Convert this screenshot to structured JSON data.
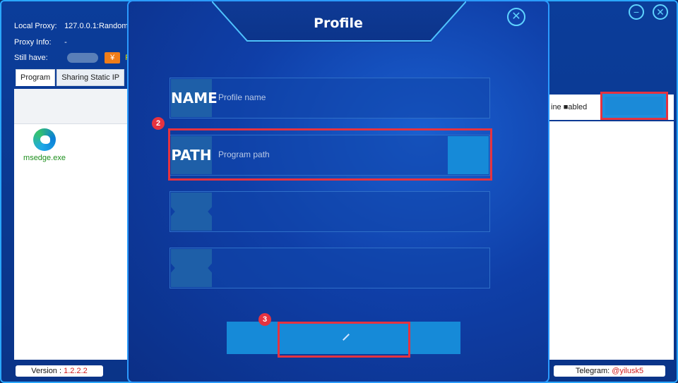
{
  "background": {
    "info": {
      "local_proxy_label": "Local Proxy:",
      "local_proxy_value": "127.0.0.1:Random",
      "proxy_info_label": "Proxy Info:",
      "proxy_info_value": "-",
      "still_have_label": "Still have:",
      "yen": "¥",
      "re_text": "Re"
    },
    "tabs": [
      "Program",
      "Sharing Static IP"
    ],
    "programs": [
      {
        "label": "msedge.exe",
        "icon": "edge-icon"
      }
    ],
    "right_column_label": "ine ■abled",
    "version_label": "Version :",
    "version_value": "1.2.2.2",
    "telegram_label": "Telegram:",
    "telegram_value": "@yilusk5"
  },
  "modal": {
    "title": "Profile",
    "close_icon": "close-icon",
    "fields": [
      {
        "badge": "NAME",
        "placeholder": "Profile name"
      },
      {
        "badge": "PATH",
        "placeholder": "Program path"
      },
      {
        "badge": "",
        "placeholder": ""
      },
      {
        "badge": "",
        "placeholder": ""
      }
    ],
    "markers": [
      "2",
      "3"
    ],
    "action_icon": "pencil-icon"
  },
  "colors": {
    "accent_cyan": "#5fd3ff",
    "highlight_red": "#e53340",
    "button_blue": "#168ad8",
    "version_red": "#d21d1d"
  }
}
